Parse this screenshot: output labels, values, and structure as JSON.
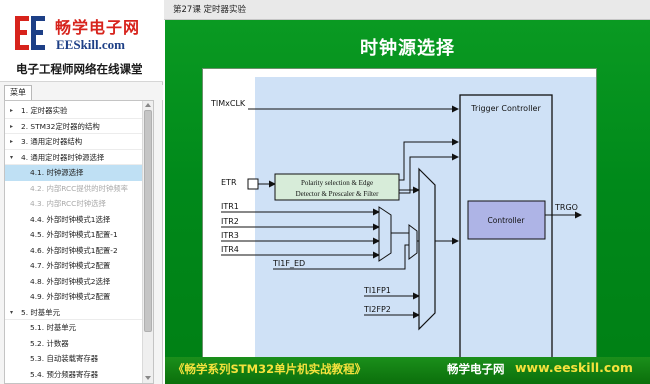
{
  "logo": {
    "title": "畅学电子网",
    "site": "EESkill.com",
    "slogan": "电子工程师网络在线课堂",
    "mark": "EE"
  },
  "menu_tab": "菜单",
  "menu_items": [
    {
      "arrow": "▸",
      "label": "1. 定时器实验",
      "level": 0,
      "state": "normal"
    },
    {
      "arrow": "▸",
      "label": "2. STM32定时器的结构",
      "level": 0,
      "state": "normal"
    },
    {
      "arrow": "▸",
      "label": "3. 通用定时器结构",
      "level": 0,
      "state": "normal"
    },
    {
      "arrow": "▾",
      "label": "4. 通用定时器时钟源选择",
      "level": 0,
      "state": "normal"
    },
    {
      "arrow": "",
      "label": "4.1. 时钟源选择",
      "level": 1,
      "state": "selected"
    },
    {
      "arrow": "",
      "label": "4.2. 内部RCC提供的时钟频率",
      "level": 1,
      "state": "dim"
    },
    {
      "arrow": "",
      "label": "4.3. 内部RCC时钟选择",
      "level": 1,
      "state": "dim"
    },
    {
      "arrow": "",
      "label": "4.4. 外部时钟模式1选择",
      "level": 1,
      "state": "normal"
    },
    {
      "arrow": "",
      "label": "4.5. 外部时钟模式1配置-1",
      "level": 1,
      "state": "normal"
    },
    {
      "arrow": "",
      "label": "4.6. 外部时钟模式1配置-2",
      "level": 1,
      "state": "normal"
    },
    {
      "arrow": "",
      "label": "4.7. 外部时钟模式2配置",
      "level": 1,
      "state": "normal"
    },
    {
      "arrow": "",
      "label": "4.8. 外部时钟模式2选择",
      "level": 1,
      "state": "normal"
    },
    {
      "arrow": "",
      "label": "4.9. 外部时钟模式2配置",
      "level": 1,
      "state": "normal"
    },
    {
      "arrow": "▾",
      "label": "5. 时基单元",
      "level": 0,
      "state": "normal"
    },
    {
      "arrow": "",
      "label": "5.1. 时基单元",
      "level": 1,
      "state": "normal"
    },
    {
      "arrow": "",
      "label": "5.2. 计数器",
      "level": 1,
      "state": "normal"
    },
    {
      "arrow": "",
      "label": "5.3. 自动装载寄存器",
      "level": 1,
      "state": "normal"
    },
    {
      "arrow": "",
      "label": "5.4. 预分频器寄存器",
      "level": 1,
      "state": "normal"
    }
  ],
  "breadcrumb": "第27课 定时器实验",
  "slide": {
    "title": "时钟源选择",
    "footer_course": "《畅学系列STM32单片机实战教程》",
    "footer_brand": "畅学电子网",
    "footer_url": "www.eeskill.com"
  },
  "diagram": {
    "timxclk": "TIMxCLK",
    "trigger_controller": "Trigger Controller",
    "etr": "ETR",
    "polarity_line1": "Polarity selection & Edge",
    "polarity_line2": "Detector & Prescaler & Filter",
    "itr1": "ITR1",
    "itr2": "ITR2",
    "itr3": "ITR3",
    "itr4": "ITR4",
    "ti1f_ed": "TI1F_ED",
    "ti1fp1": "TI1FP1",
    "ti2fp2": "TI2FP2",
    "controller": "Controller",
    "trgo": "TRGO"
  },
  "colors": {
    "slide_green": "#008a18",
    "diagram_blue": "#cfe1f6",
    "controller_fill": "#aeb4e6",
    "title_red": "#d7231c",
    "footer_yellow": "#f5e23d"
  }
}
